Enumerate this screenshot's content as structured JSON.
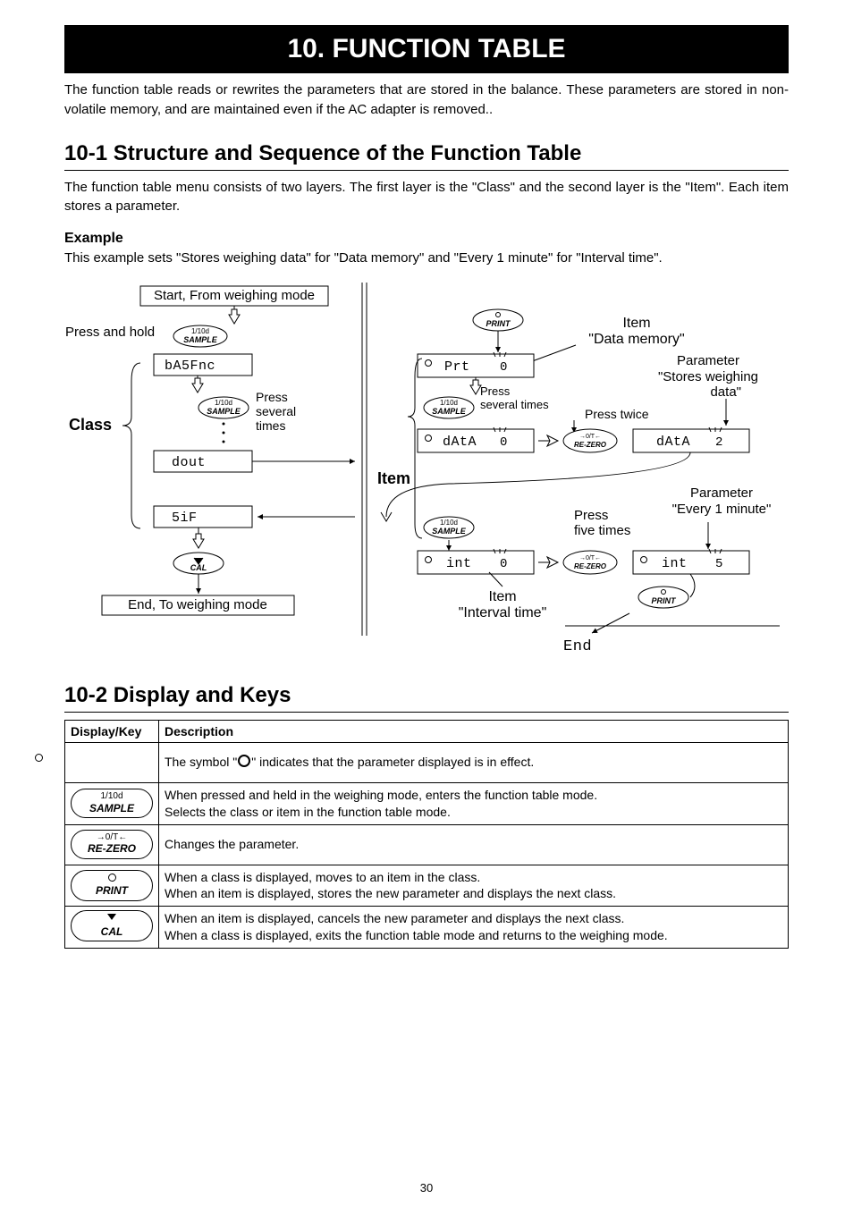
{
  "title": "10.  FUNCTION TABLE",
  "intro": "The function table reads or rewrites the parameters that are stored in the balance. These parameters are stored in non-volatile memory, and are maintained even if the AC adapter is removed..",
  "section1": {
    "heading": "10-1  Structure and Sequence of the Function Table",
    "para": "The function table menu consists of two layers. The first layer is the \"Class\" and the second layer is the \"Item\". Each item stores a parameter.",
    "example_heading": "Example",
    "example_para": "This example sets \"Stores weighing data\" for \"Data memory\" and \"Every 1 minute\" for \"Interval time\"."
  },
  "diagram": {
    "start": "Start, From weighing mode",
    "press_hold": "Press and hold",
    "class_label": "Class",
    "item_label": "Item",
    "press": "Press",
    "press_several": "Press\nseveral\ntimes",
    "press_several2": "Press\nseveral times",
    "press_twice": "Press twice",
    "press_five": "Press\nfive times",
    "end": "End, To weighing mode",
    "lcd_basfnc": "bA5Fnc",
    "lcd_dout": "dout",
    "lcd_sif": "5iF",
    "lcd_prt": "Prt",
    "lcd_data": "dAtA",
    "lcd_data2": "dAtA",
    "lcd_int": "int",
    "lcd_int2": "int",
    "lcd_zero1": "0",
    "lcd_zero2": "0",
    "lcd_zero3": "0",
    "lcd_two": "2",
    "lcd_five": "5",
    "lcd_end": "End",
    "note_item_data": "Item\n\"Data memory\"",
    "note_param_stores": "Parameter\n\"Stores weighing\ndata\"",
    "note_param_every": "Parameter\n\"Every 1 minute\"",
    "note_item_interval": "Item\n\"Interval time\"",
    "key_sample_top": "1/10d",
    "key_sample": "SAMPLE",
    "key_print_top": "",
    "key_print": "PRINT",
    "key_rezero_top": "→0/T←",
    "key_rezero": "RE-ZERO",
    "key_cal": "CAL"
  },
  "section2": {
    "heading": "10-2  Display and Keys",
    "th_key": "Display/Key",
    "th_desc": "Description",
    "rows": [
      {
        "key_type": "circle",
        "key_top": "",
        "key_main": "",
        "desc_pre": "The symbol \"",
        "desc_post": "\" indicates that the parameter displayed is in effect."
      },
      {
        "key_type": "oval",
        "key_top": "1/10d",
        "key_main": "SAMPLE",
        "desc": "When pressed and held in the weighing mode, enters the function table mode.\nSelects the class or item in the function table mode."
      },
      {
        "key_type": "oval",
        "key_top": "→0/T←",
        "key_main": "RE-ZERO",
        "desc": "Changes the parameter."
      },
      {
        "key_type": "oval-circ",
        "key_top": "",
        "key_main": "PRINT",
        "desc": "When a class is displayed, moves to an item in the class.\nWhen an item is displayed, stores the new parameter and displays the next class."
      },
      {
        "key_type": "oval-tri",
        "key_top": "",
        "key_main": "CAL",
        "desc": "When an item is displayed, cancels the new parameter and displays the next class.\nWhen a class is displayed, exits the function table mode and returns to the weighing mode."
      }
    ]
  },
  "page_number": "30"
}
